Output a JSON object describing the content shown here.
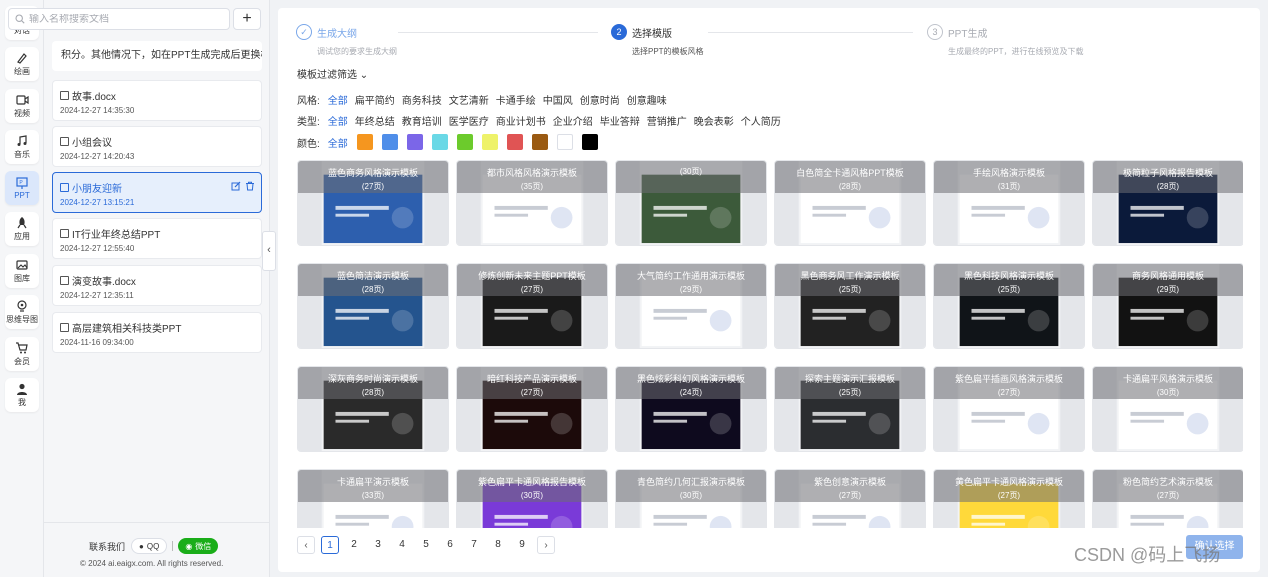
{
  "rail": [
    {
      "label": "对话",
      "icon": "chat-icon"
    },
    {
      "label": "绘画",
      "icon": "brush-icon"
    },
    {
      "label": "视频",
      "icon": "video-icon"
    },
    {
      "label": "音乐",
      "icon": "music-icon"
    },
    {
      "label": "PPT",
      "icon": "ppt-icon"
    },
    {
      "label": "应用",
      "icon": "rocket-icon"
    },
    {
      "label": "图库",
      "icon": "image-icon"
    },
    {
      "label": "思维导图",
      "icon": "mindmap-icon"
    },
    {
      "label": "会员",
      "icon": "cart-icon"
    },
    {
      "label": "我",
      "icon": "user-icon"
    }
  ],
  "search": {
    "placeholder": "输入名称搜索文档",
    "add_label": "+"
  },
  "hint": "积分。其他情况下，如在PPT生成完成后更换模",
  "history": [
    {
      "title": "故事.docx",
      "date": "2024-12-27 14:35:30"
    },
    {
      "title": "小组会议",
      "date": "2024-12-27 14:20:43"
    },
    {
      "title": "小朋友迎新",
      "date": "2024-12-27 13:15:21",
      "active": true
    },
    {
      "title": "IT行业年终总结PPT",
      "date": "2024-12-27 12:55:40"
    },
    {
      "title": "演变故事.docx",
      "date": "2024-12-27 12:35:11"
    },
    {
      "title": "高层建筑相关科技类PPT",
      "date": "2024-11-16 09:34:00"
    }
  ],
  "footer": {
    "contact": "联系我们",
    "qq": "QQ",
    "wechat": "微信",
    "copyright": "© 2024 ai.eaigx.com. All rights reserved."
  },
  "collapse_icon": "chevron-left-icon",
  "steps": [
    {
      "num": "✓",
      "name": "生成大纲",
      "desc": "调试您的要求生成大纲"
    },
    {
      "num": "2",
      "name": "选择模版",
      "desc": "选择PPT的模板风格"
    },
    {
      "num": "3",
      "name": "PPT生成",
      "desc": "生成最终的PPT，进行在线预览及下载"
    }
  ],
  "filter_toggle": "模板过滤筛选",
  "style_filter": {
    "label": "风格:",
    "options": [
      "全部",
      "扁平简约",
      "商务科技",
      "文艺清新",
      "卡通手绘",
      "中国风",
      "创意时尚",
      "创意趣味"
    ]
  },
  "type_filter": {
    "label": "类型:",
    "options": [
      "全部",
      "年终总结",
      "教育培训",
      "医学医疗",
      "商业计划书",
      "企业介绍",
      "毕业答辩",
      "营销推广",
      "晚会表彰",
      "个人简历"
    ]
  },
  "color_filter": {
    "label": "颜色:",
    "all": "全部",
    "colors": [
      "#f5961f",
      "#4f8ee9",
      "#7b66e8",
      "#6ad8e6",
      "#6ccb2c",
      "#eef26a",
      "#e05454",
      "#9a5a12",
      "#ffffff",
      "#000000"
    ]
  },
  "templates": [
    {
      "title": "蓝色商务风格演示模板",
      "pages": "(27页)",
      "theme": "#2d5fae"
    },
    {
      "title": "都市风格风格演示模板",
      "pages": "(35页)",
      "theme": "#ffffff"
    },
    {
      "title": "",
      "pages": "(30页)",
      "theme": "#3c5a3a"
    },
    {
      "title": "白色简全卡通风格PPT模板",
      "pages": "(28页)",
      "theme": "#ffffff"
    },
    {
      "title": "手绘风格演示模板",
      "pages": "(31页)",
      "theme": "#ffffff"
    },
    {
      "title": "极简粒子风格报告模板",
      "pages": "(28页)",
      "theme": "#0b1a3a"
    },
    {
      "title": "蓝色简洁演示模板",
      "pages": "(28页)",
      "theme": "#24548e"
    },
    {
      "title": "修炼创新未来主题PPT模板",
      "pages": "(27页)",
      "theme": "#1a1a1a"
    },
    {
      "title": "大气简约工作通用演示模板",
      "pages": "(29页)",
      "theme": "#ffffff"
    },
    {
      "title": "黑色商务风工作演示模板",
      "pages": "(25页)",
      "theme": "#222222"
    },
    {
      "title": "黑色科技风格演示模板",
      "pages": "(25页)",
      "theme": "#101418"
    },
    {
      "title": "商务风格通用模板",
      "pages": "(29页)",
      "theme": "#121212"
    },
    {
      "title": "深灰商务时尚演示模板",
      "pages": "(28页)",
      "theme": "#2a2a2a"
    },
    {
      "title": "暗红科技产品演示模板",
      "pages": "(27页)",
      "theme": "#1c0a0a"
    },
    {
      "title": "黑色炫彩科幻风格演示模板",
      "pages": "(24页)",
      "theme": "#0e0a1e"
    },
    {
      "title": "探索主题演示汇报模板",
      "pages": "(25页)",
      "theme": "#2b2d30"
    },
    {
      "title": "紫色扁平插画风格演示模板",
      "pages": "(27页)",
      "theme": "#ffffff"
    },
    {
      "title": "卡通扁平风格演示模板",
      "pages": "(30页)",
      "theme": "#ffffff"
    },
    {
      "title": "卡通扁平演示模板",
      "pages": "(33页)",
      "theme": "#ffffff"
    },
    {
      "title": "紫色扁平卡通风格报告模板",
      "pages": "(30页)",
      "theme": "#7a3ad8"
    },
    {
      "title": "青色简约几何汇报演示模板",
      "pages": "(30页)",
      "theme": "#ffffff"
    },
    {
      "title": "紫色创意演示模板",
      "pages": "(27页)",
      "theme": "#ffffff"
    },
    {
      "title": "黄色扁平卡通风格演示模板",
      "pages": "(27页)",
      "theme": "#ffd93a"
    },
    {
      "title": "粉色简约艺术演示模板",
      "pages": "(27页)",
      "theme": "#ffffff"
    }
  ],
  "pager": {
    "prev": "‹",
    "next": "›",
    "pages": [
      "1",
      "2",
      "3",
      "4",
      "5",
      "6",
      "7",
      "8",
      "9"
    ],
    "current": "1"
  },
  "confirm_label": "确认选择",
  "watermark": "CSDN @码上飞扬"
}
